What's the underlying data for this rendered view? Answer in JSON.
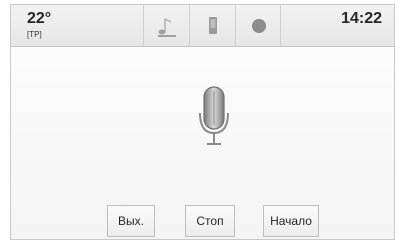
{
  "status": {
    "temperature": "22°",
    "traffic_program": "[TP]",
    "time": "14:22"
  },
  "tabs": [
    {
      "icon": "music-note-icon"
    },
    {
      "icon": "phone-icon"
    },
    {
      "icon": "dot-icon"
    }
  ],
  "main": {
    "icon": "microphone-icon"
  },
  "buttons": {
    "exit_label": "Вых.",
    "stop_label": "Стоп",
    "start_label": "Начало"
  }
}
